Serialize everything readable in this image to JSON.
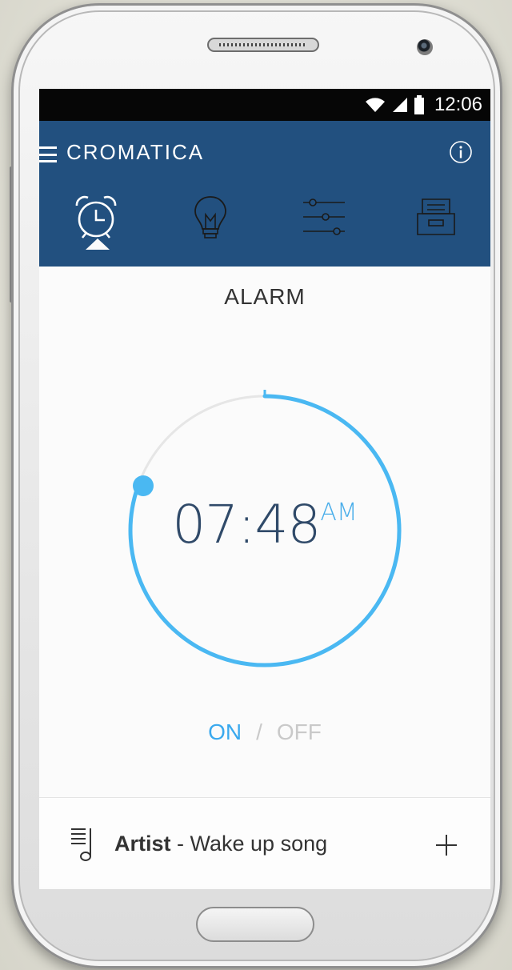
{
  "status_bar": {
    "time": "12:06"
  },
  "app_bar": {
    "title": "CROMATICA"
  },
  "tabs": [
    {
      "id": "alarm",
      "icon": "alarm-clock-icon",
      "active": true
    },
    {
      "id": "light",
      "icon": "light-bulb-icon",
      "active": false
    },
    {
      "id": "settings",
      "icon": "sliders-icon",
      "active": false
    },
    {
      "id": "archive",
      "icon": "archive-drawer-icon",
      "active": false
    }
  ],
  "alarm": {
    "section_title": "ALARM",
    "time": "07:48",
    "ampm": "AM",
    "on_label": "ON",
    "separator": "/",
    "off_label": "OFF",
    "state": "on"
  },
  "song": {
    "artist": "Artist",
    "separator": " - ",
    "title": "Wake up song"
  },
  "colors": {
    "app_bar": "#22507f",
    "accent": "#4ab8f2",
    "screen_bg": "#fbfbfb",
    "time_text": "#304a69"
  }
}
